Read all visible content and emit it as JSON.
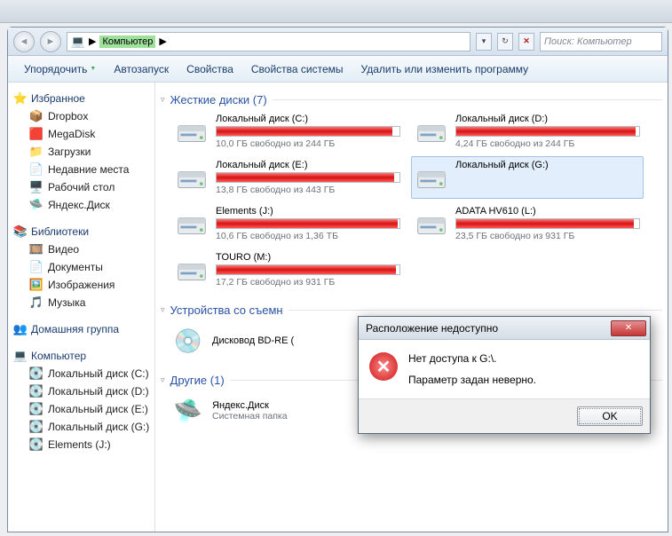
{
  "address": {
    "crumb": "Компьютер",
    "arrow": "▶"
  },
  "search": {
    "placeholder": "Поиск: Компьютер"
  },
  "toolbar": {
    "organize": "Упорядочить",
    "autoplay": "Автозапуск",
    "properties": "Свойства",
    "sys_properties": "Свойства системы",
    "change_prog": "Удалить или изменить программу"
  },
  "sidebar": {
    "fav_hdr": "Избранное",
    "favorites": [
      {
        "label": "Dropbox",
        "icon": "📦"
      },
      {
        "label": "MegaDisk",
        "icon": "🟥"
      },
      {
        "label": "Загрузки",
        "icon": "📁"
      },
      {
        "label": "Недавние места",
        "icon": "📄"
      },
      {
        "label": "Рабочий стол",
        "icon": "🖥️"
      },
      {
        "label": "Яндекс.Диск",
        "icon": "🛸"
      }
    ],
    "lib_hdr": "Библиотеки",
    "libraries": [
      {
        "label": "Видео",
        "icon": "🎞️"
      },
      {
        "label": "Документы",
        "icon": "📄"
      },
      {
        "label": "Изображения",
        "icon": "🖼️"
      },
      {
        "label": "Музыка",
        "icon": "🎵"
      }
    ],
    "home_hdr": "Домашняя группа",
    "comp_hdr": "Компьютер",
    "drives": [
      {
        "label": "Локальный диск (C:)"
      },
      {
        "label": "Локальный диск (D:)"
      },
      {
        "label": "Локальный диск (E:)"
      },
      {
        "label": "Локальный диск (G:)"
      },
      {
        "label": "Elements (J:)"
      }
    ]
  },
  "sections": {
    "hdd_hdr": "Жесткие диски (7)",
    "removable_hdr": "Устройства со съемн",
    "other_hdr": "Другие (1)"
  },
  "drives": [
    {
      "name": "Локальный диск (C:)",
      "stat": "10,0 ГБ свободно из 244 ГБ",
      "fill": 96
    },
    {
      "name": "Локальный диск (D:)",
      "stat": "4,24 ГБ свободно из 244 ГБ",
      "fill": 98
    },
    {
      "name": "Локальный диск (E:)",
      "stat": "13,8 ГБ свободно из 443 ГБ",
      "fill": 97
    },
    {
      "name": "Локальный диск (G:)",
      "stat": "",
      "fill": 0,
      "selected": true,
      "nobar": true
    },
    {
      "name": "Elements (J:)",
      "stat": "10,6 ГБ свободно из 1,36 ТБ",
      "fill": 99
    },
    {
      "name": "ADATA HV610 (L:)",
      "stat": "23,5 ГБ свободно из 931 ГБ",
      "fill": 97
    },
    {
      "name": "TOURO (M:)",
      "stat": "17,2 ГБ свободно из 931 ГБ",
      "fill": 98
    }
  ],
  "removable": {
    "name": "Дисковод BD-RE ("
  },
  "other": {
    "name": "Яндекс.Диск",
    "sub": "Системная папка"
  },
  "dialog": {
    "title": "Расположение недоступно",
    "line1": "Нет доступа к G:\\.",
    "line2": "Параметр задан неверно.",
    "ok": "OK"
  }
}
